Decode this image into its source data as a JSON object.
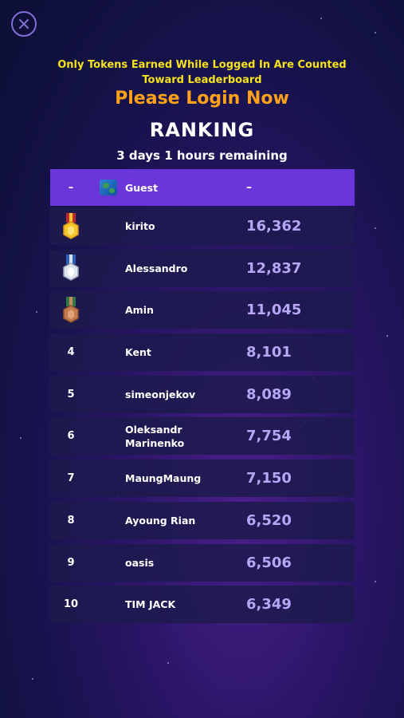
{
  "notice": {
    "line1": "Only Tokens Earned While Logged In Are Counted",
    "line2": "Toward Leaderboard"
  },
  "login_prompt": "Please Login Now",
  "title": "RANKING",
  "remaining": "3 days 1 hours remaining",
  "guest": {
    "rank": "–",
    "name": "Guest",
    "score": "–",
    "icon": "globe-icon"
  },
  "rows": [
    {
      "rank": "1",
      "name": "kirito",
      "score": "16,362",
      "medal": "gold"
    },
    {
      "rank": "2",
      "name": "Alessandro",
      "score": "12,837",
      "medal": "silver"
    },
    {
      "rank": "3",
      "name": "Amin",
      "score": "11,045",
      "medal": "bronze"
    },
    {
      "rank": "4",
      "name": "Kent",
      "score": "8,101"
    },
    {
      "rank": "5",
      "name": "simeonjekov",
      "score": "8,089"
    },
    {
      "rank": "6",
      "name": "Oleksandr Marinenko",
      "score": "7,754"
    },
    {
      "rank": "7",
      "name": "MaungMaung",
      "score": "7,150"
    },
    {
      "rank": "8",
      "name": "Ayoung Rian",
      "score": "6,520"
    },
    {
      "rank": "9",
      "name": "oasis",
      "score": "6,506"
    },
    {
      "rank": "10",
      "name": "TIM JACK",
      "score": "6,349"
    }
  ],
  "colors": {
    "notice": "#f6e21c",
    "login": "#ffa21a",
    "guest_row": "#6b36d9",
    "score": "#b7a6f5"
  }
}
